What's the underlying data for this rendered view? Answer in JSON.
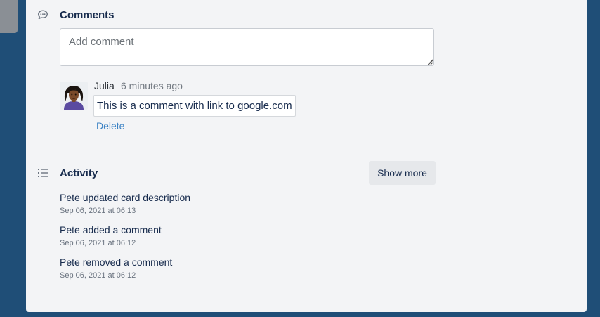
{
  "comments": {
    "title": "Comments",
    "icon": "speech-bubble-icon",
    "input_placeholder": "Add comment",
    "items": [
      {
        "author": "Julia",
        "time": "6 minutes ago",
        "text_prefix": "This is a comment with link to ",
        "link_text": "google.com",
        "delete_label": "Delete"
      }
    ]
  },
  "activity": {
    "title": "Activity",
    "icon": "list-icon",
    "show_more_label": "Show more",
    "items": [
      {
        "text": "Pete updated card description",
        "date": "Sep 06, 2021 at 06:13"
      },
      {
        "text": "Pete added a comment",
        "date": "Sep 06, 2021 at 06:12"
      },
      {
        "text": "Pete removed a comment",
        "date": "Sep 06, 2021 at 06:12"
      }
    ]
  },
  "colors": {
    "background": "#1f4e77",
    "panel": "#f3f4f6",
    "link": "#3b82c4",
    "button": "#e6e8eb"
  }
}
